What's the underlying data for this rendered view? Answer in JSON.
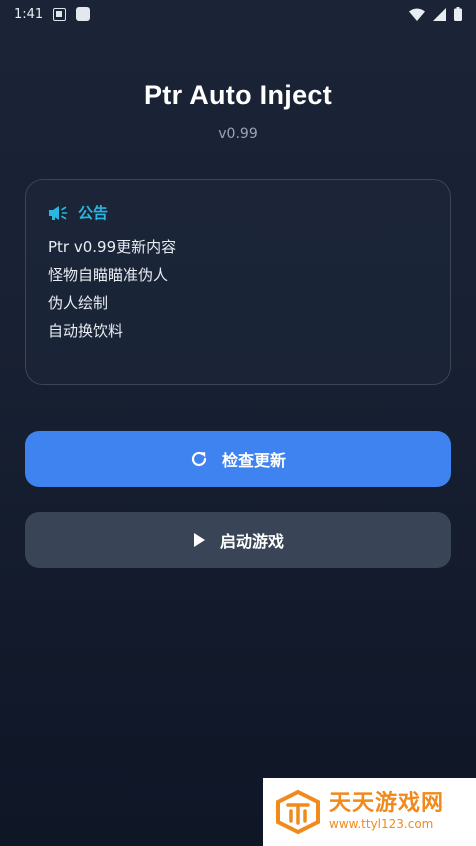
{
  "status_bar": {
    "time": "1:41"
  },
  "app": {
    "title": "Ptr Auto Inject",
    "version": "v0.99"
  },
  "notice": {
    "icon": "megaphone-icon",
    "title": "公告",
    "lines": [
      "Ptr v0.99更新内容",
      "怪物自瞄瞄准伪人",
      "伪人绘制",
      "自动换饮料"
    ]
  },
  "buttons": {
    "update": {
      "label": "检查更新",
      "icon": "refresh-icon"
    },
    "launch": {
      "label": "启动游戏",
      "icon": "play-icon"
    }
  },
  "watermark": {
    "name": "天天游戏网",
    "url": "www.ttyl123.com"
  },
  "colors": {
    "accent": "#3f83f0",
    "notice_title": "#29b6e0",
    "secondary_button": "#394556",
    "background": "#182133"
  }
}
